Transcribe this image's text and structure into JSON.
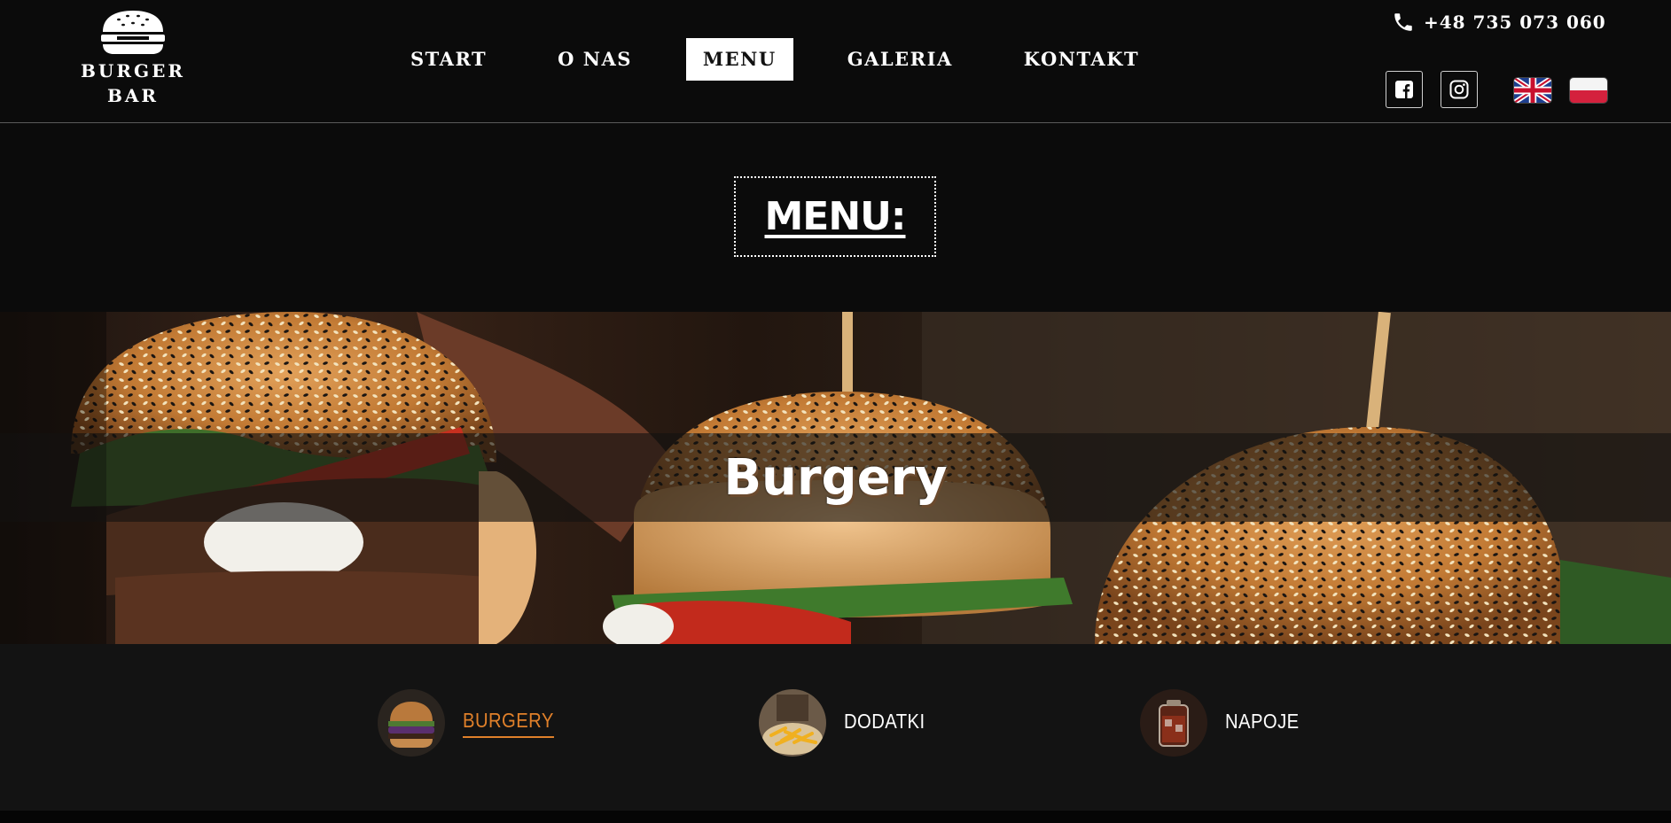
{
  "brand": {
    "logo_line1": "BURGER",
    "logo_line2": "BAR"
  },
  "nav": {
    "items": [
      {
        "label": "START"
      },
      {
        "label": "O NAS"
      },
      {
        "label": "MENU",
        "active": true
      },
      {
        "label": "GALERIA"
      },
      {
        "label": "KONTAKT"
      }
    ]
  },
  "contact": {
    "phone": "+48 735 073 060"
  },
  "social": {
    "facebook_icon": "facebook-icon",
    "instagram_icon": "instagram-icon"
  },
  "languages": [
    {
      "code": "en",
      "icon": "uk-flag"
    },
    {
      "code": "pl",
      "icon": "poland-flag"
    }
  ],
  "menu_section": {
    "title": "MENU:"
  },
  "hero": {
    "title": "Burgery"
  },
  "categories": [
    {
      "label": "BURGERY",
      "active": true,
      "thumb": "burger-thumb"
    },
    {
      "label": "DODATKI",
      "active": false,
      "thumb": "fries-thumb"
    },
    {
      "label": "NAPOJE",
      "active": false,
      "thumb": "drink-thumb"
    }
  ],
  "colors": {
    "background": "#0b0b0b",
    "accent": "#e0802a",
    "panel": "#131313"
  }
}
